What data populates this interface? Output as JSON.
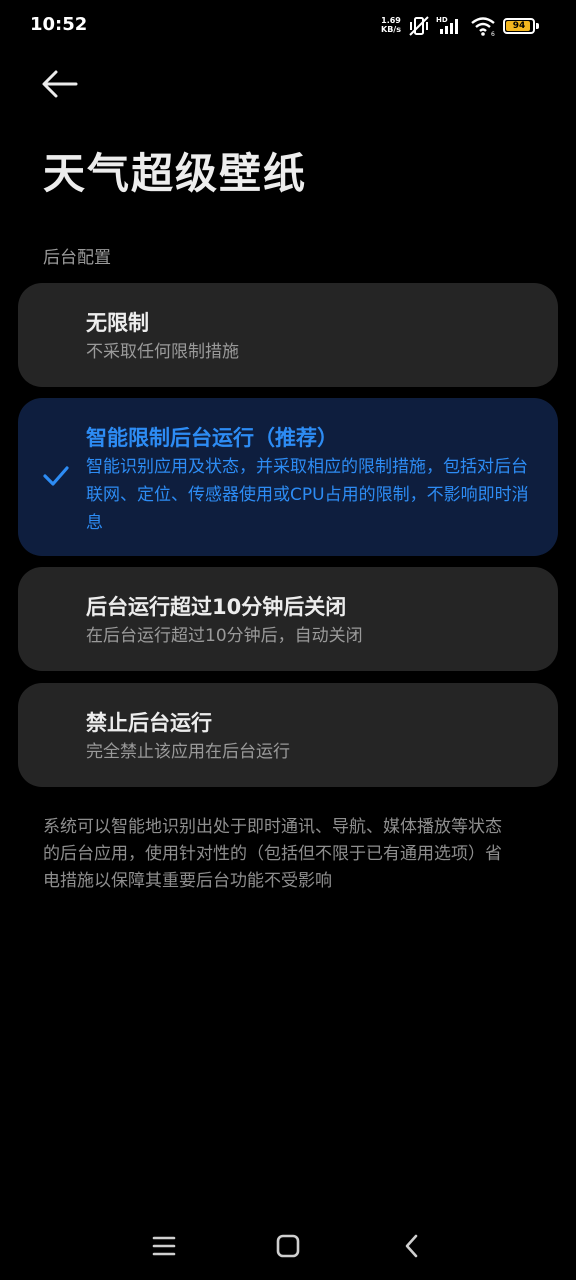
{
  "status": {
    "time": "10:52",
    "net_speed": "1.69",
    "net_unit": "KB/s",
    "battery": "94",
    "battery_level": 0.94,
    "battery_color": "#f3b61f",
    "icons": [
      "mute-vibrate-icon",
      "cellular-hd-signal-icon",
      "wifi-icon",
      "battery-icon"
    ]
  },
  "header": {
    "back_icon": "arrow-left-icon",
    "title": "天气超级壁纸"
  },
  "section_label": "后台配置",
  "options": [
    {
      "title": "无限制",
      "desc": "不采取任何限制措施",
      "selected": false
    },
    {
      "title": "智能限制后台运行（推荐）",
      "desc": "智能识别应用及状态，并采取相应的限制措施，包括对后台联网、定位、传感器使用或CPU占用的限制，不影响即时消息",
      "selected": true
    },
    {
      "title": "后台运行超过10分钟后关闭",
      "desc": "在后台运行超过10分钟后，自动关闭",
      "selected": false
    },
    {
      "title": "禁止后台运行",
      "desc": "完全禁止该应用在后台运行",
      "selected": false
    }
  ],
  "accent_color": "#2d8cf4",
  "footnote": "系统可以智能地识别出处于即时通讯、导航、媒体播放等状态的后台应用，使用针对性的（包括但不限于已有通用选项）省电措施以保障其重要后台功能不受影响",
  "navbar": {
    "icons": [
      "menu-icon",
      "home-icon",
      "back-icon"
    ]
  }
}
